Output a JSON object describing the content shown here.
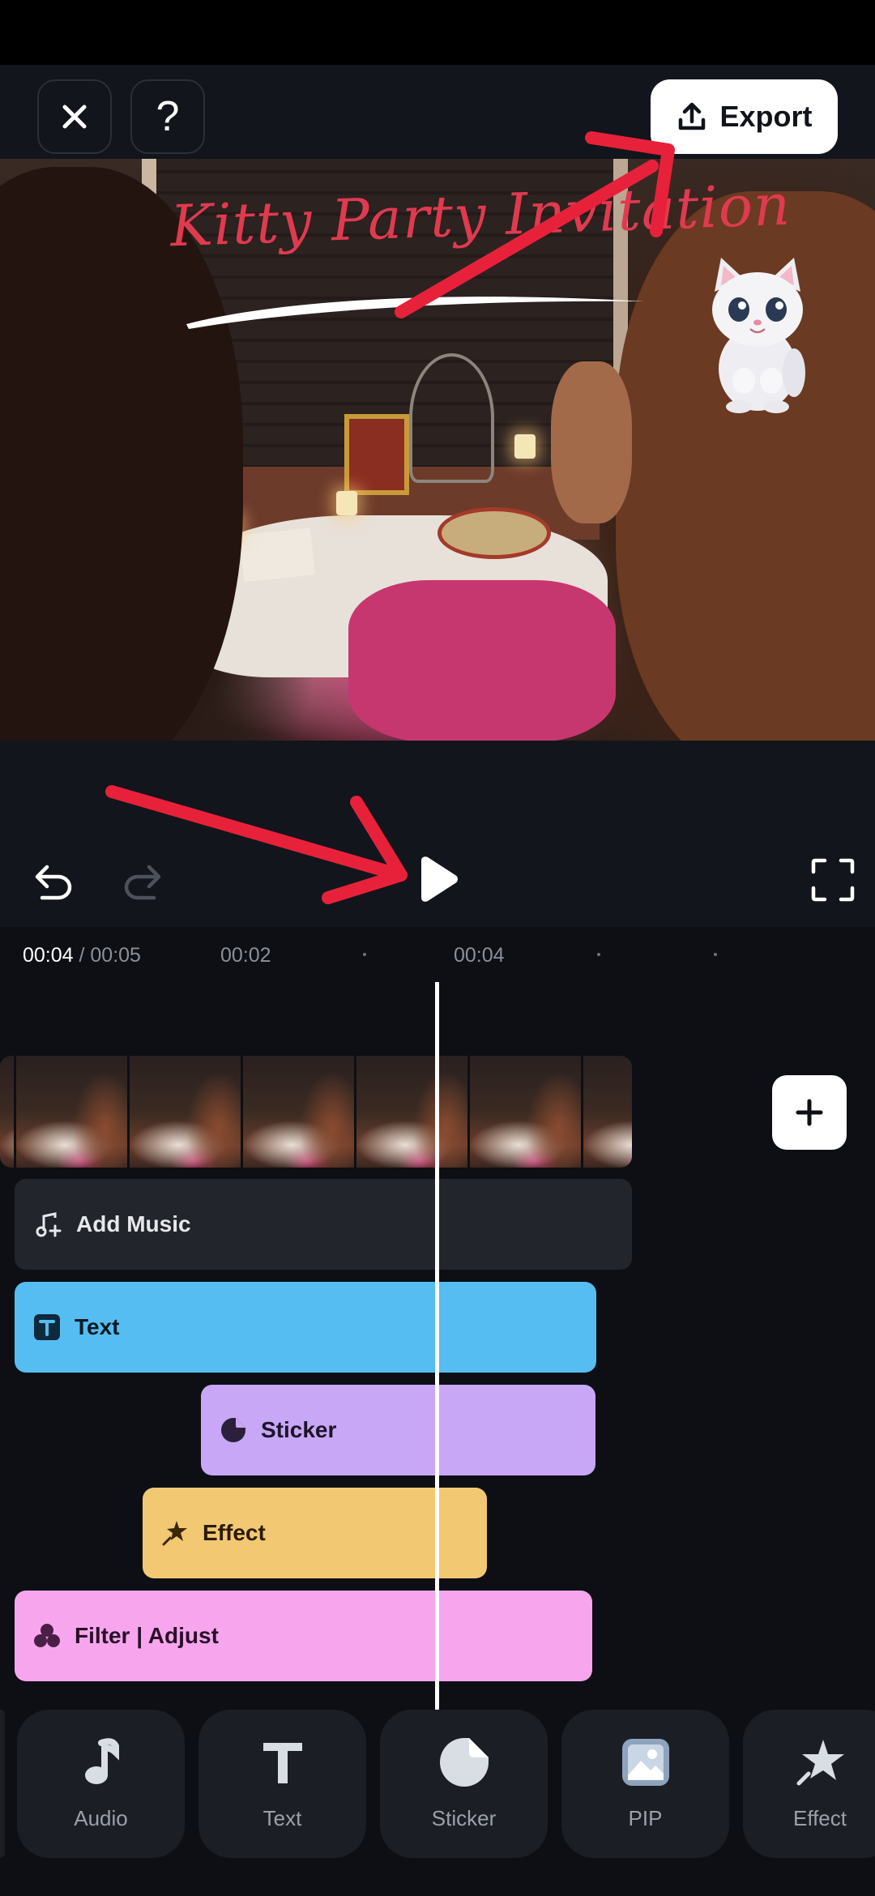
{
  "app": {
    "close_label": "✕",
    "help_label": "?",
    "export_label": "Export"
  },
  "preview": {
    "overlay_text": "Kitty Party Invitation",
    "sticker_name": "cat-sticker"
  },
  "playback": {
    "current_time": "00:04",
    "total_time": " / 00:05",
    "ticks": [
      "00:02",
      "00:04"
    ]
  },
  "tracks": {
    "music": "Add Music",
    "text": "Text",
    "sticker": "Sticker",
    "effect": "Effect",
    "filter": "Filter | Adjust"
  },
  "bottom_nav": [
    {
      "label": "Audio",
      "icon": "music-note-icon"
    },
    {
      "label": "Text",
      "icon": "text-t-icon"
    },
    {
      "label": "Sticker",
      "icon": "sticker-icon"
    },
    {
      "label": "PIP",
      "icon": "image-icon"
    },
    {
      "label": "Effect",
      "icon": "star-effect-icon"
    }
  ],
  "colors": {
    "text_track": "#55bdf1",
    "sticker_track": "#c8a7f6",
    "effect_track": "#f3c873",
    "filter_track": "#f7a6ee",
    "annotation_arrow": "#e8213a"
  }
}
